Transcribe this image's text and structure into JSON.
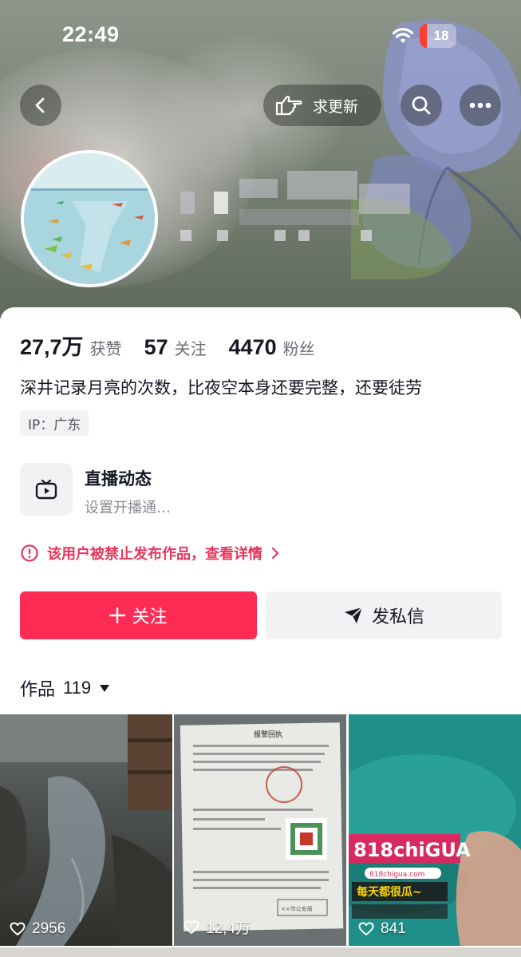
{
  "status_bar": {
    "time": "22:49",
    "battery": "18"
  },
  "header": {
    "request_update_label": "求更新"
  },
  "profile": {
    "stats": [
      {
        "value": "27,7万",
        "label": "获赞"
      },
      {
        "value": "57",
        "label": "关注"
      },
      {
        "value": "4470",
        "label": "粉丝"
      }
    ],
    "bio": "深井记录月亮的次数，比夜空本身还要完整，还要徒劳",
    "ip": "IP：广东"
  },
  "live": {
    "title": "直播动态",
    "subtitle": "设置开播通…"
  },
  "notice": {
    "text": "该用户被禁止发布作品，查看详情"
  },
  "actions": {
    "follow": "关注",
    "message": "发私信"
  },
  "works": {
    "label": "作品",
    "count": "119",
    "items": [
      {
        "likes": "2956"
      },
      {
        "likes": "12,4万"
      },
      {
        "likes": "841"
      }
    ]
  },
  "thumb2": {
    "title": "报警回执",
    "stamp": "××市公安局"
  },
  "thumb3": {
    "brand": "818chiGUA",
    "site": "818chigua.com",
    "slogan": "每天都很瓜~"
  },
  "colors": {
    "accent": "#fe2c55",
    "notice": "#e8365d"
  }
}
